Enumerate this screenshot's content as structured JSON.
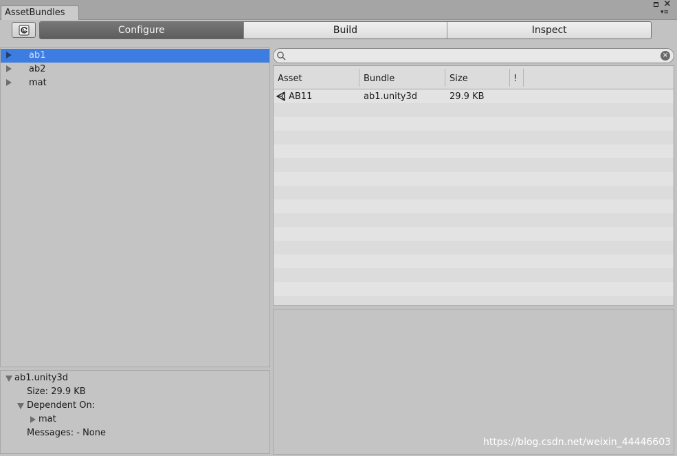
{
  "window": {
    "tab_title": "AssetBundles",
    "close_glyph": "✕",
    "menu_glyph": "▾≡"
  },
  "toolbar": {
    "refresh_icon": "refresh-icon",
    "modes": [
      {
        "label": "Configure",
        "active": true
      },
      {
        "label": "Build",
        "active": false
      },
      {
        "label": "Inspect",
        "active": false
      }
    ]
  },
  "bundle_tree": {
    "items": [
      {
        "label": "ab1",
        "selected": true
      },
      {
        "label": "ab2",
        "selected": false
      },
      {
        "label": "mat",
        "selected": false
      }
    ]
  },
  "details": {
    "bundle_name": "ab1.unity3d",
    "size_line": "Size: 29.9 KB",
    "dependent_on_label": "Dependent On:",
    "dependency": "mat",
    "messages_line": "Messages: - None"
  },
  "search": {
    "value": "",
    "placeholder": ""
  },
  "asset_table": {
    "columns": [
      "Asset",
      "Bundle",
      "Size",
      "!"
    ],
    "rows": [
      {
        "asset": "AB11",
        "bundle": "ab1.unity3d",
        "size": "29.9 KB",
        "icon": "unity-icon"
      }
    ]
  },
  "watermark": "https://blog.csdn.net/weixin_44446603",
  "colors": {
    "selection": "#3d7ce0",
    "active_mode": "#666666",
    "panel_bg": "#c4c4c4"
  }
}
